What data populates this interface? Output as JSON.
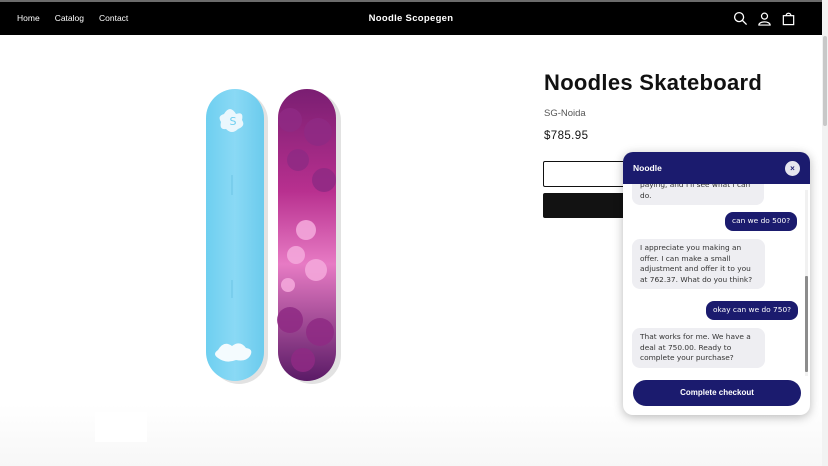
{
  "header": {
    "nav": [
      "Home",
      "Catalog",
      "Contact"
    ],
    "brand": "Noodle Scopegen",
    "icons": [
      "search-icon",
      "account-icon",
      "cart-icon"
    ]
  },
  "product": {
    "title": "Noodles Skateboard",
    "vendor": "SG-Noida",
    "price": "$785.95"
  },
  "chat": {
    "title": "Noodle",
    "close_label": "×",
    "messages": [
      {
        "role": "bot",
        "text": "paying, and I'll see what I can do."
      },
      {
        "role": "user",
        "text": "can we do 500?"
      },
      {
        "role": "bot",
        "text": "I appreciate you making an offer. I can make a small adjustment and offer it to you at 762.37. What do you think?"
      },
      {
        "role": "user",
        "text": "okay can we do 750?"
      },
      {
        "role": "bot",
        "text": "That works for me. We have a deal at 750.00. Ready to complete your purchase?"
      }
    ],
    "checkout_label": "Complete checkout"
  },
  "colors": {
    "header_bg": "#000000",
    "chat_accent": "#1b1b6e",
    "bot_bubble": "#eeeef2"
  }
}
